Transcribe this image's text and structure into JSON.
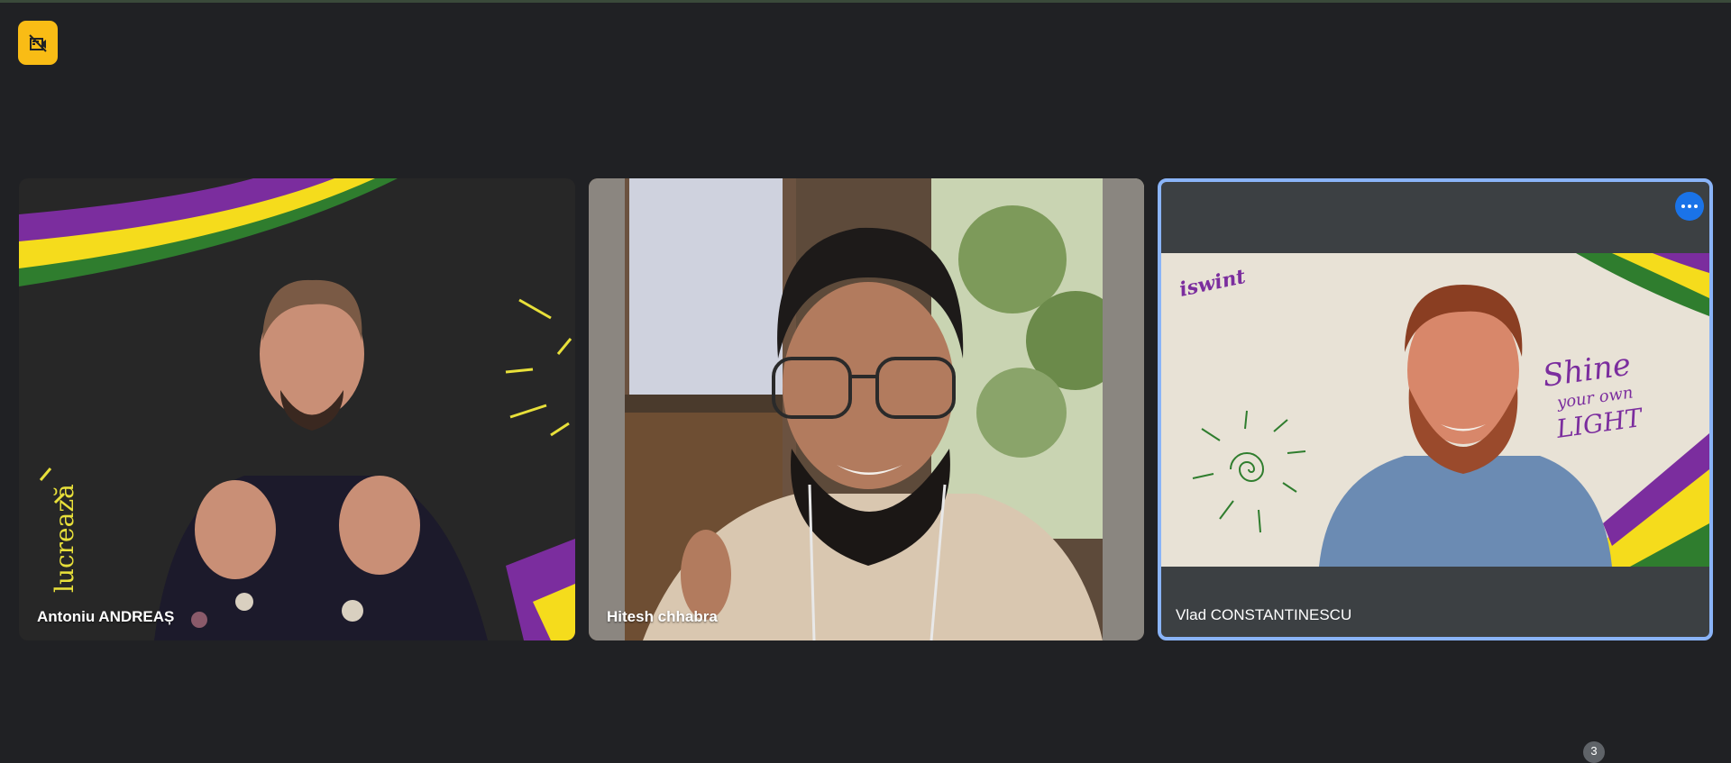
{
  "meeting": {
    "status_icon": "camera-off-icon",
    "status_color": "#f9bc15",
    "participant_count": "3"
  },
  "participants": [
    {
      "name": "Antoniu ANDREAȘ"
    },
    {
      "name": "Hitesh chhabra"
    },
    {
      "name": "Vlad CONSTANTINESCU",
      "active_speaker": true,
      "highlight_color": "#8ab4f8"
    }
  ],
  "backgrounds": {
    "tile1_text": "lucrează",
    "tile3_logo": "iswint",
    "tile3_slogan_line1": "Shine",
    "tile3_slogan_line2": "your own",
    "tile3_slogan_line3": "LIGHT"
  },
  "colors": {
    "stripe_purple": "#7b2d9e",
    "stripe_yellow": "#f5dc1c",
    "stripe_green": "#2f7d2e",
    "accent_blue": "#1a73e8"
  }
}
